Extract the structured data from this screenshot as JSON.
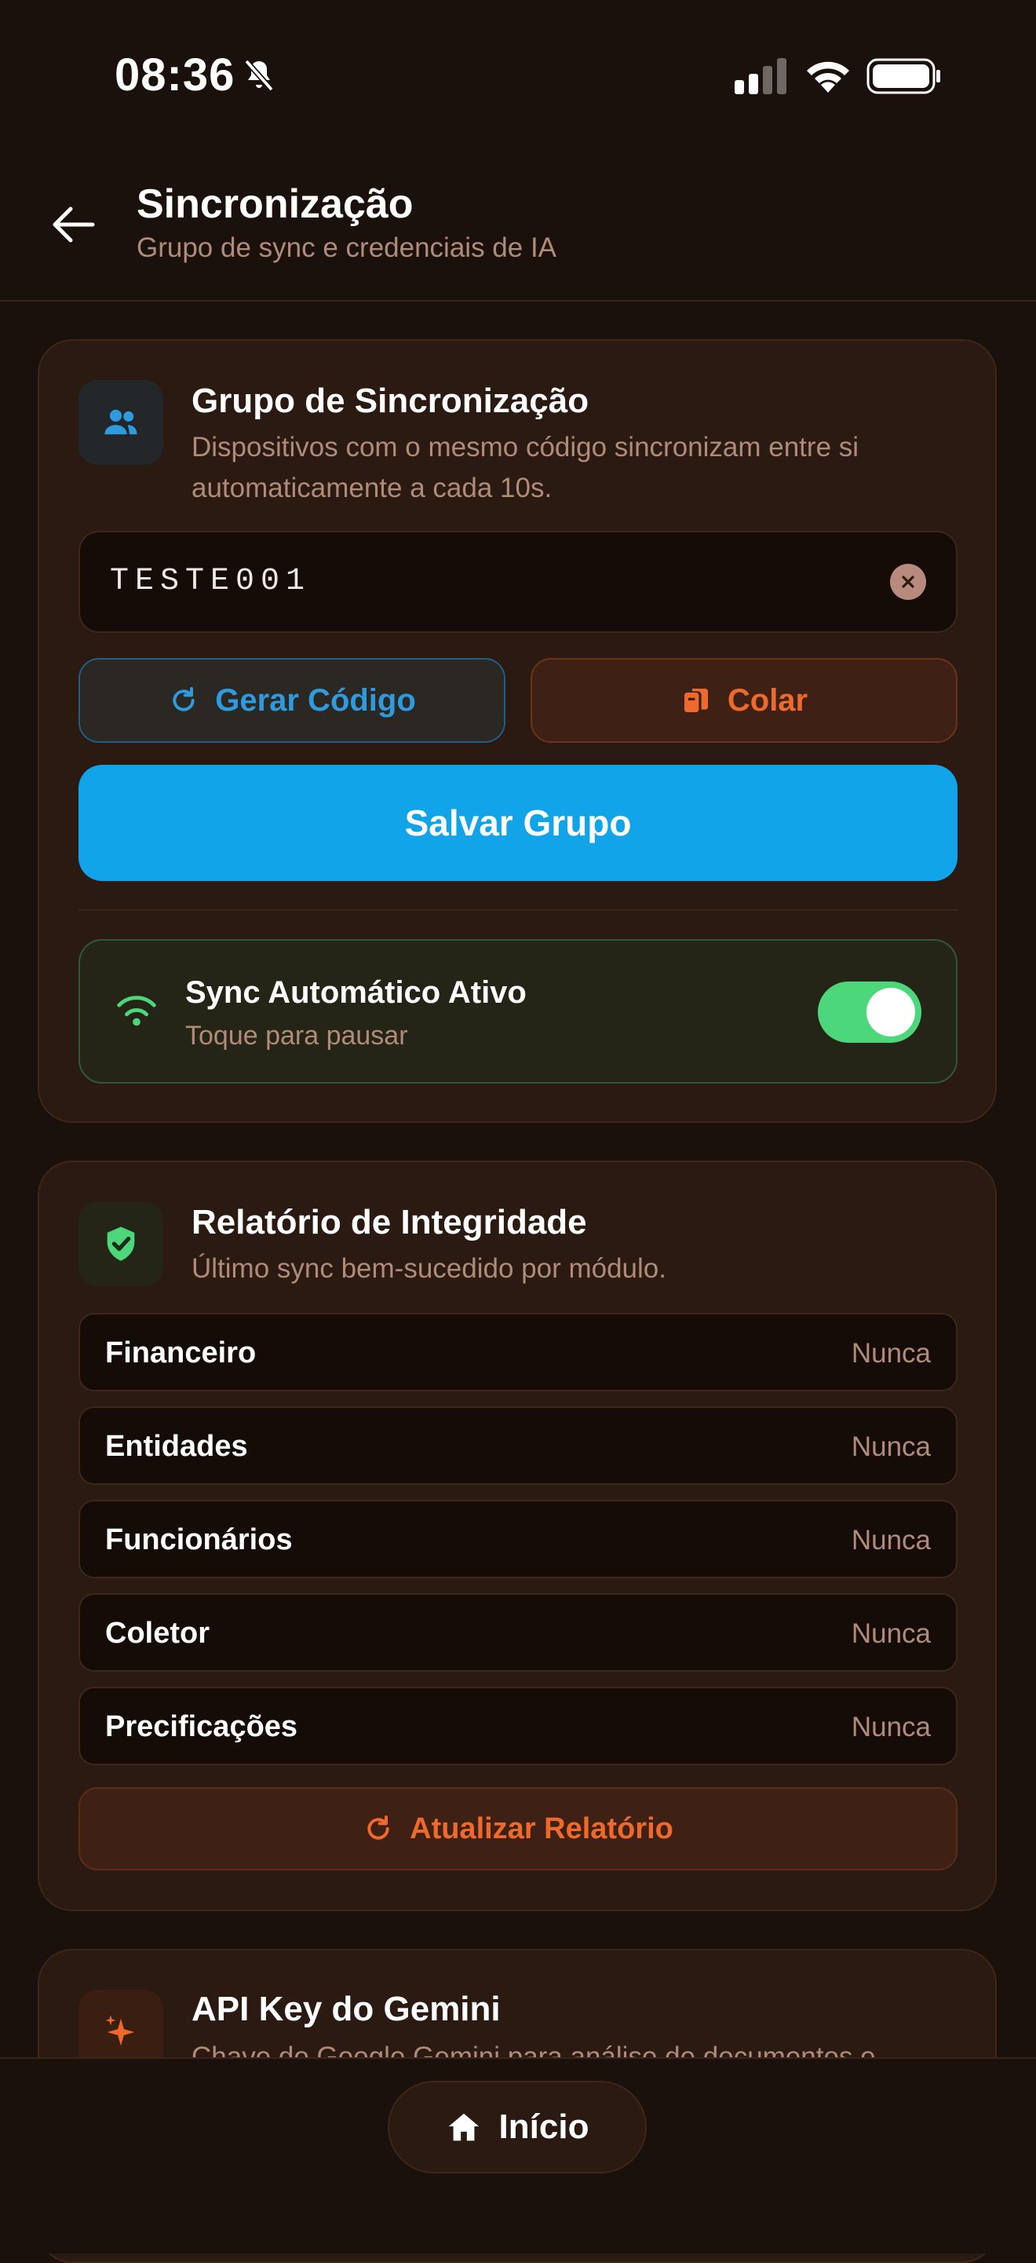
{
  "status_bar": {
    "time": "08:36"
  },
  "header": {
    "title": "Sincronização",
    "subtitle": "Grupo de sync e credenciais de IA"
  },
  "sync_group": {
    "title": "Grupo de Sincronização",
    "description": "Dispositivos com o mesmo código sincronizam entre si automaticamente a cada 10s.",
    "code_value": "TESTE001",
    "generate_label": "Gerar Código",
    "paste_label": "Colar",
    "save_label": "Salvar Grupo",
    "auto_sync": {
      "title": "Sync Automático Ativo",
      "subtitle": "Toque para pausar",
      "enabled": true
    }
  },
  "integrity": {
    "title": "Relatório de Integridade",
    "description": "Último sync bem-sucedido por módulo.",
    "rows": [
      {
        "label": "Financeiro",
        "value": "Nunca"
      },
      {
        "label": "Entidades",
        "value": "Nunca"
      },
      {
        "label": "Funcionários",
        "value": "Nunca"
      },
      {
        "label": "Coletor",
        "value": "Nunca"
      },
      {
        "label": "Precificações",
        "value": "Nunca"
      }
    ],
    "refresh_label": "Atualizar Relatório"
  },
  "gemini": {
    "title": "API Key do Gemini",
    "description": "Chave do Google Gemini para análise de documentos e"
  },
  "bottom_nav": {
    "home_label": "Início"
  },
  "colors": {
    "background": "#1b110c",
    "card": "#2a1a12",
    "primary_blue": "#11a4e8",
    "accent_orange": "#ee6a2c",
    "toggle_green": "#4cd87a"
  }
}
